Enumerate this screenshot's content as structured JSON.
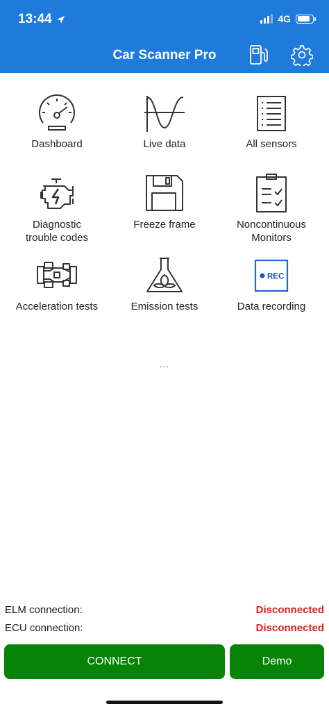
{
  "status": {
    "time": "13:44",
    "network": "4G"
  },
  "header": {
    "title": "Car Scanner Pro",
    "fuel_icon": "fuel-pump-icon",
    "settings_icon": "gear-icon"
  },
  "menu": [
    {
      "label": "Dashboard",
      "icon": "speedometer-icon"
    },
    {
      "label": "Live data",
      "icon": "waveform-icon"
    },
    {
      "label": "All sensors",
      "icon": "list-icon"
    },
    {
      "label": "Diagnostic\ntrouble codes",
      "icon": "engine-icon"
    },
    {
      "label": "Freeze frame",
      "icon": "floppy-disk-icon"
    },
    {
      "label": "Noncontinuous\nMonitors",
      "icon": "clipboard-checklist-icon"
    },
    {
      "label": "Acceleration tests",
      "icon": "race-car-icon"
    },
    {
      "label": "Emission tests",
      "icon": "flask-leaf-icon"
    },
    {
      "label": "Data recording",
      "icon": "rec-icon",
      "rec_text": "REC"
    }
  ],
  "more": "...",
  "connection": {
    "elm_label": "ELM connection:",
    "elm_status": "Disconnected",
    "ecu_label": "ECU connection:",
    "ecu_status": "Disconnected"
  },
  "buttons": {
    "connect": "CONNECT",
    "demo": "Demo"
  },
  "colors": {
    "header": "#1e7bdc",
    "status_error": "#e0211b",
    "button": "#078407"
  }
}
